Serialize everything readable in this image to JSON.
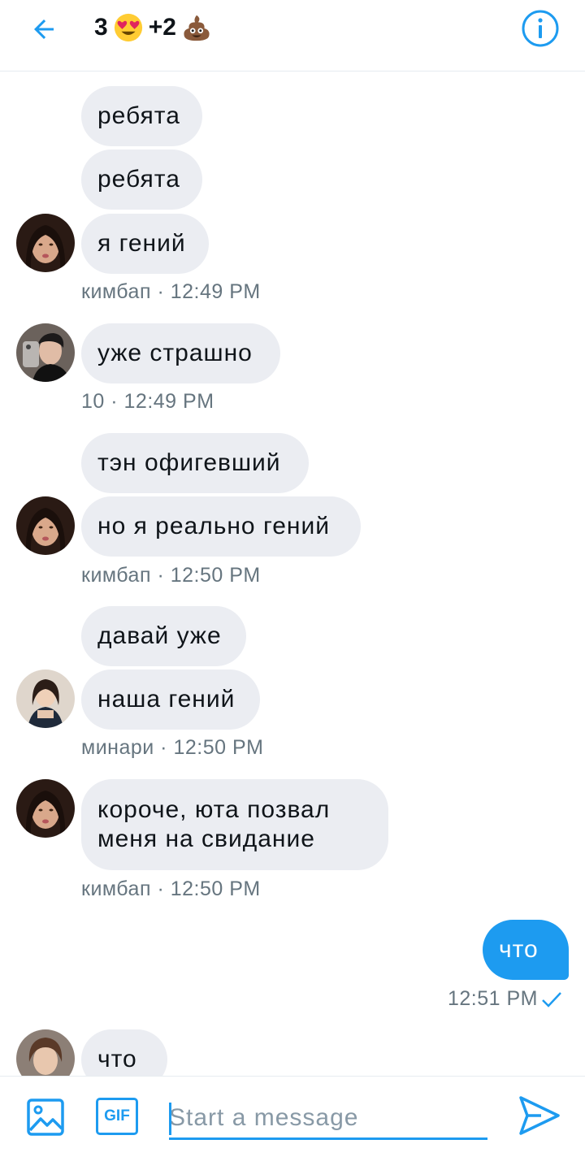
{
  "header": {
    "title_prefix": "3",
    "title_middle": "+2",
    "emoji_left": "heart-eyes-emoji",
    "emoji_right": "pile-of-poo-emoji",
    "back_icon": "arrow-left-icon",
    "info_icon": "info-icon"
  },
  "messages": [
    {
      "text": "ребята",
      "from": "кимбап"
    },
    {
      "text": "ребята",
      "from": "кимбап"
    },
    {
      "text": "я гений",
      "from": "кимбап"
    },
    {
      "meta": "кимбап · 12:49 PM"
    },
    {
      "text": "уже страшно",
      "from": "10"
    },
    {
      "meta": "10 · 12:49 PM"
    },
    {
      "text": "тэн офигевший",
      "from": "кимбап"
    },
    {
      "text": "но я реально гений",
      "from": "кимбап"
    },
    {
      "meta": "кимбап · 12:50 PM"
    },
    {
      "text": "давай уже",
      "from": "минари"
    },
    {
      "text": "наша гений",
      "from": "минари"
    },
    {
      "meta": "минари · 12:50 PM"
    },
    {
      "text": "короче, юта позвал меня на свидание",
      "from": "кимбап"
    },
    {
      "meta": "кимбап · 12:50 PM"
    },
    {
      "text": "что",
      "from": "me"
    },
    {
      "meta": "12:51 PM",
      "status": "sent-check-icon"
    },
    {
      "text": "что",
      "from": "unknown"
    }
  ],
  "composer": {
    "placeholder": "Start a message",
    "value": "",
    "gif_label": "GIF",
    "image_icon": "image-icon",
    "send_icon": "send-icon"
  },
  "colors": {
    "accent": "#1d9bf0",
    "incoming_bubble": "#ebedf2",
    "meta_text": "#66757f"
  }
}
